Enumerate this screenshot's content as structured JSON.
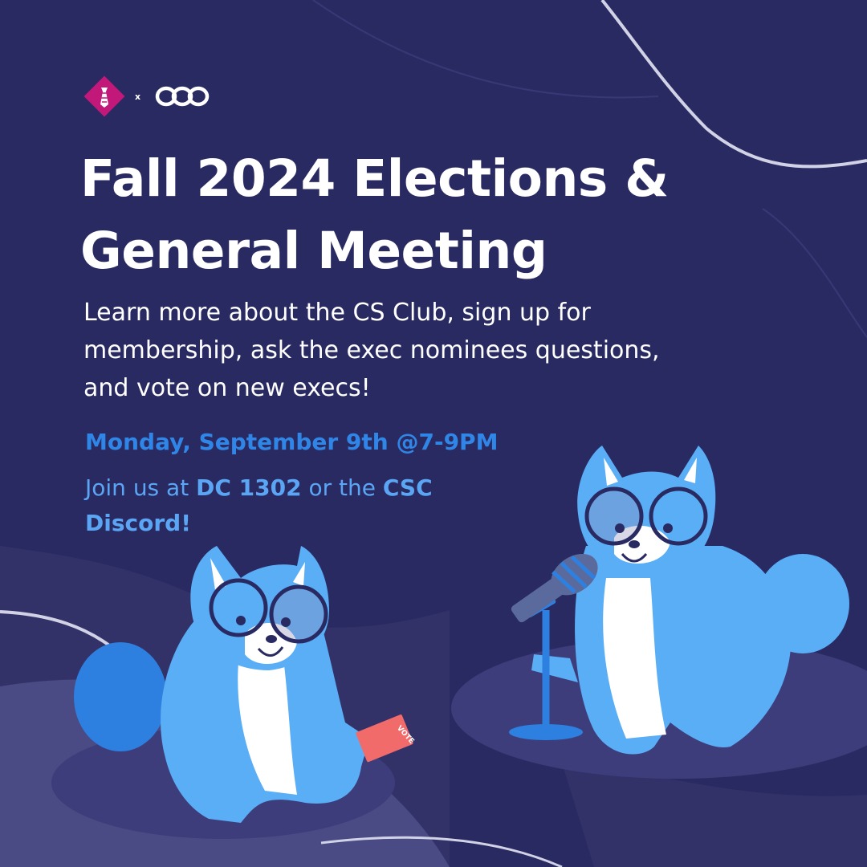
{
  "logos": {
    "left_logo": "diamond-tie-logo",
    "separator": "x",
    "right_logo": "interlocking-rings-logo"
  },
  "title": {
    "line1": "Fall 2024 Elections &",
    "line2": "General Meeting"
  },
  "description": {
    "line1": "Learn more about the CS Club, sign up for",
    "line2": "membership, ask the exec nominees questions,",
    "line3": "and vote on new execs!"
  },
  "date": "Monday, September 9th @7-9PM",
  "venue": {
    "prefix": "Join us at ",
    "room": "DC 1302",
    "middle": " or the ",
    "org": "CSC",
    "platform": "Discord!"
  },
  "ballot_label": "VOTE",
  "colors": {
    "background": "#2a2a63",
    "accent_blue": "#2f86e6",
    "light_blue": "#5aa6f4",
    "mascot_blue": "#5aaef6",
    "logo_magenta": "#c2187a",
    "ballot_red": "#f26b6b"
  }
}
